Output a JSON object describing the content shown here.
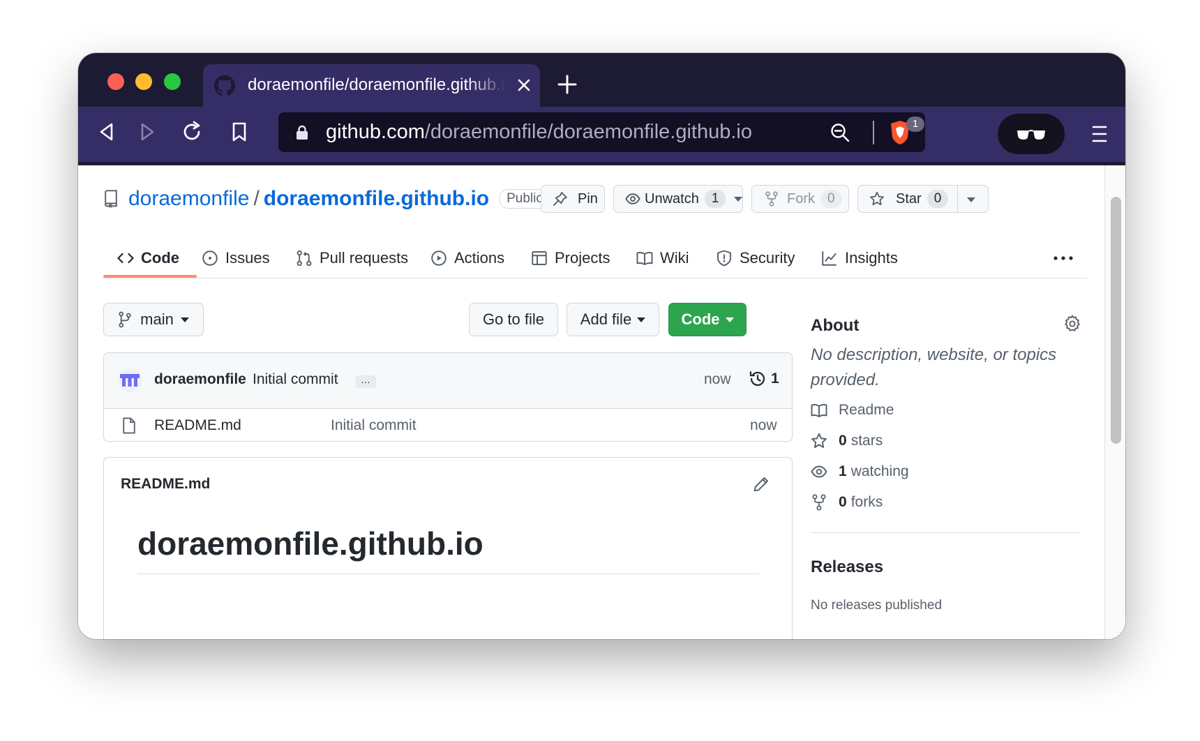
{
  "browser": {
    "tab_title": "doraemonfile/doraemonfile.github.io",
    "url_host": "github.com",
    "url_path": "/doraemonfile/doraemonfile.github.io",
    "shields_count": "1"
  },
  "repo": {
    "owner": "doraemonfile",
    "separator": "/",
    "name": "doraemonfile.github.io",
    "visibility": "Public"
  },
  "header_buttons": {
    "pin": "Pin",
    "unwatch": "Unwatch",
    "watch_count": "1",
    "fork": "Fork",
    "fork_count": "0",
    "star": "Star",
    "star_count": "0"
  },
  "tabs": [
    {
      "label": "Code",
      "icon": "code-icon",
      "selected": true
    },
    {
      "label": "Issues",
      "icon": "issue-icon"
    },
    {
      "label": "Pull requests",
      "icon": "pull-request-icon"
    },
    {
      "label": "Actions",
      "icon": "play-icon"
    },
    {
      "label": "Projects",
      "icon": "table-icon"
    },
    {
      "label": "Wiki",
      "icon": "book-icon"
    },
    {
      "label": "Security",
      "icon": "shield-icon"
    },
    {
      "label": "Insights",
      "icon": "graph-icon"
    }
  ],
  "file_nav": {
    "branch": "main",
    "go_to_file": "Go to file",
    "add_file": "Add file",
    "code": "Code"
  },
  "latest_commit": {
    "author": "doraemonfile",
    "message": "Initial commit",
    "ellipsis": "…",
    "time": "now",
    "commit_count": "1"
  },
  "files": [
    {
      "name": "README.md",
      "message": "Initial commit",
      "time": "now"
    }
  ],
  "readme": {
    "label": "README.md",
    "heading": "doraemonfile.github.io"
  },
  "about": {
    "title": "About",
    "description": "No description, website, or topics provided.",
    "readme_label": "Readme",
    "stars_count": "0",
    "stars_label": "stars",
    "watching_count": "1",
    "watching_label": "watching",
    "forks_count": "0",
    "forks_label": "forks"
  },
  "releases": {
    "title": "Releases",
    "subtitle": "No releases published"
  },
  "colors": {
    "link": "#0969da",
    "primary_button": "#2da44e",
    "tab_underline": "#fd8c73",
    "browser_chrome": "#342d66"
  }
}
